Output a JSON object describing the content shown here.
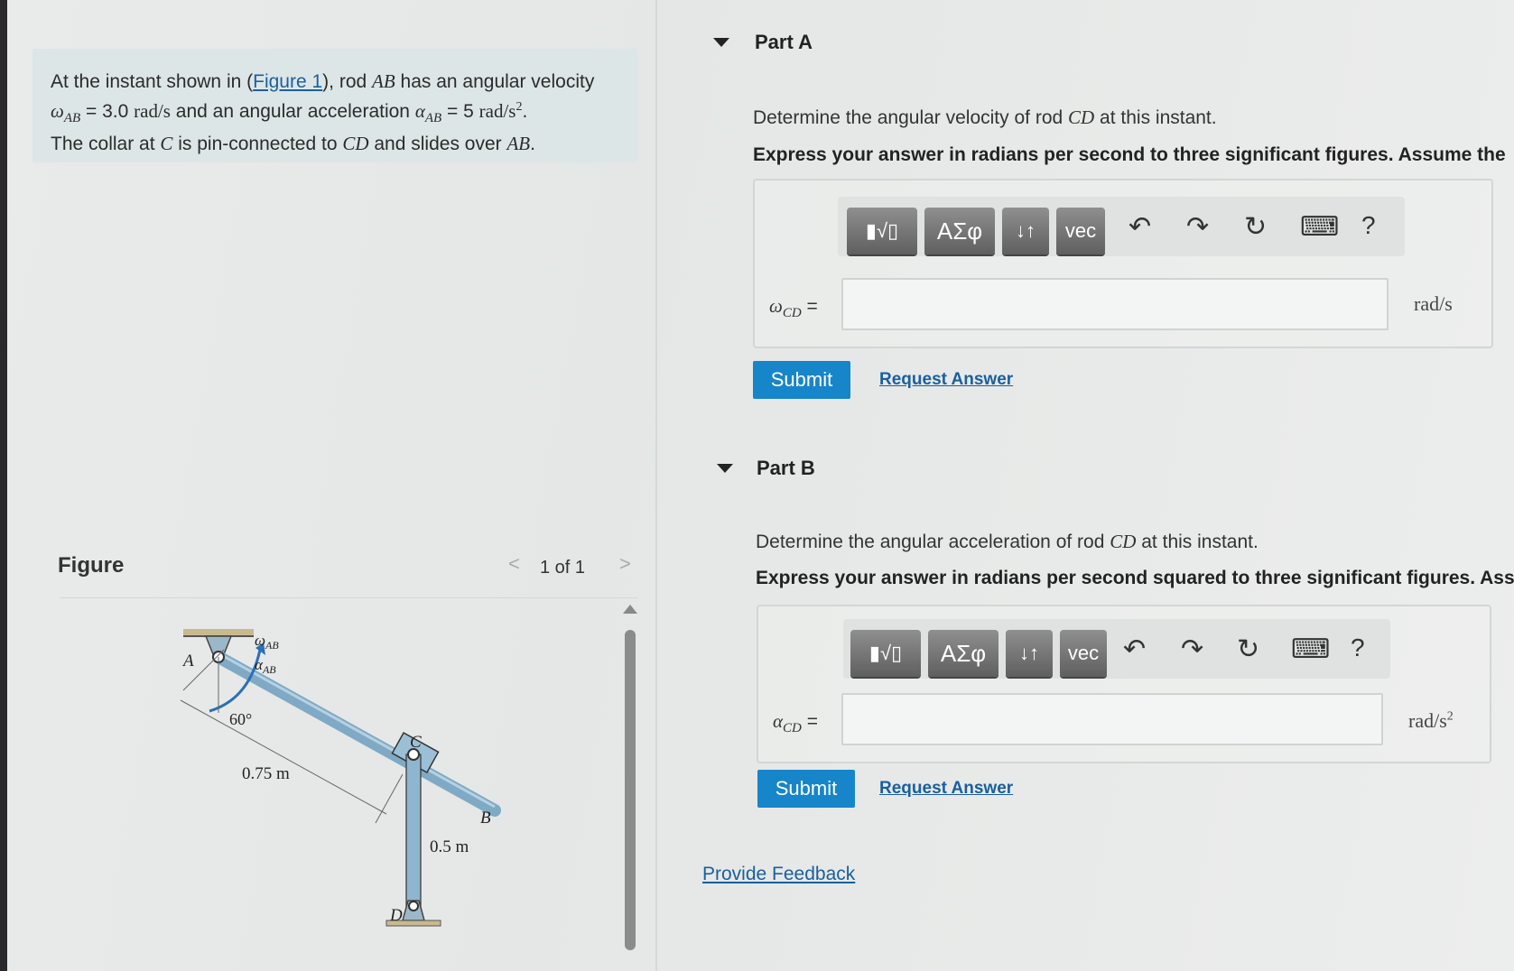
{
  "problem": {
    "text_1": "At the instant shown in (",
    "figure_link": "Figure 1",
    "text_2": "), rod ",
    "rod_ab": "AB",
    "text_3": " has an angular velocity",
    "omega_ab": "ω",
    "omega_ab_sub": "AB",
    "omega_value": " = 3.0 ",
    "omega_unit": "rad/s",
    "text_4": " and an angular acceleration ",
    "alpha_ab": "α",
    "alpha_ab_sub": "AB",
    "alpha_value": " = 5 ",
    "alpha_unit": "rad/s",
    "alpha_unit_sup": "2",
    "text_5": ".",
    "text_6": "The collar at ",
    "c": "C",
    "text_7": " is pin-connected to ",
    "cd": "CD",
    "text_8": " and slides over ",
    "ab2": "AB",
    "text_9": "."
  },
  "figure": {
    "title": "Figure",
    "prev": "<",
    "next": ">",
    "count": "1 of 1",
    "labels": {
      "omega": "ω",
      "omega_sub": "AB",
      "alpha": "α",
      "alpha_sub": "AB",
      "a": "A",
      "b": "B",
      "c": "C",
      "d": "D",
      "angle": "60°",
      "len_ab": "0.75 m",
      "len_cd": "0.5 m"
    }
  },
  "partA": {
    "title": "Part A",
    "question_1": "Determine the angular velocity of rod ",
    "question_cd": "CD",
    "question_2": " at this instant.",
    "instruction": "Express your answer in radians per second to three significant figures. Assume the",
    "toolbar": [
      "▮√▯",
      "ΑΣφ",
      "↓↑",
      "vec"
    ],
    "var": "ω",
    "var_sub": "CD",
    "eq": " =",
    "unit": "rad/s",
    "submit": "Submit",
    "request": "Request Answer"
  },
  "partB": {
    "title": "Part B",
    "question_1": "Determine the angular acceleration of rod ",
    "question_cd": "CD",
    "question_2": " at this instant.",
    "instruction": "Express your answer in radians per second squared to three significant figures. Assu",
    "toolbar": [
      "▮√▯",
      "ΑΣφ",
      "↓↑",
      "vec"
    ],
    "var": "α",
    "var_sub": "CD",
    "eq": " =",
    "unit": "rad/s",
    "unit_sup": "2",
    "submit": "Submit",
    "request": "Request Answer"
  },
  "toolbar_icons": {
    "undo": "↶",
    "redo": "↷",
    "reset": "↻",
    "keyboard": "⌨",
    "help": "?"
  },
  "feedback": "Provide Feedback"
}
